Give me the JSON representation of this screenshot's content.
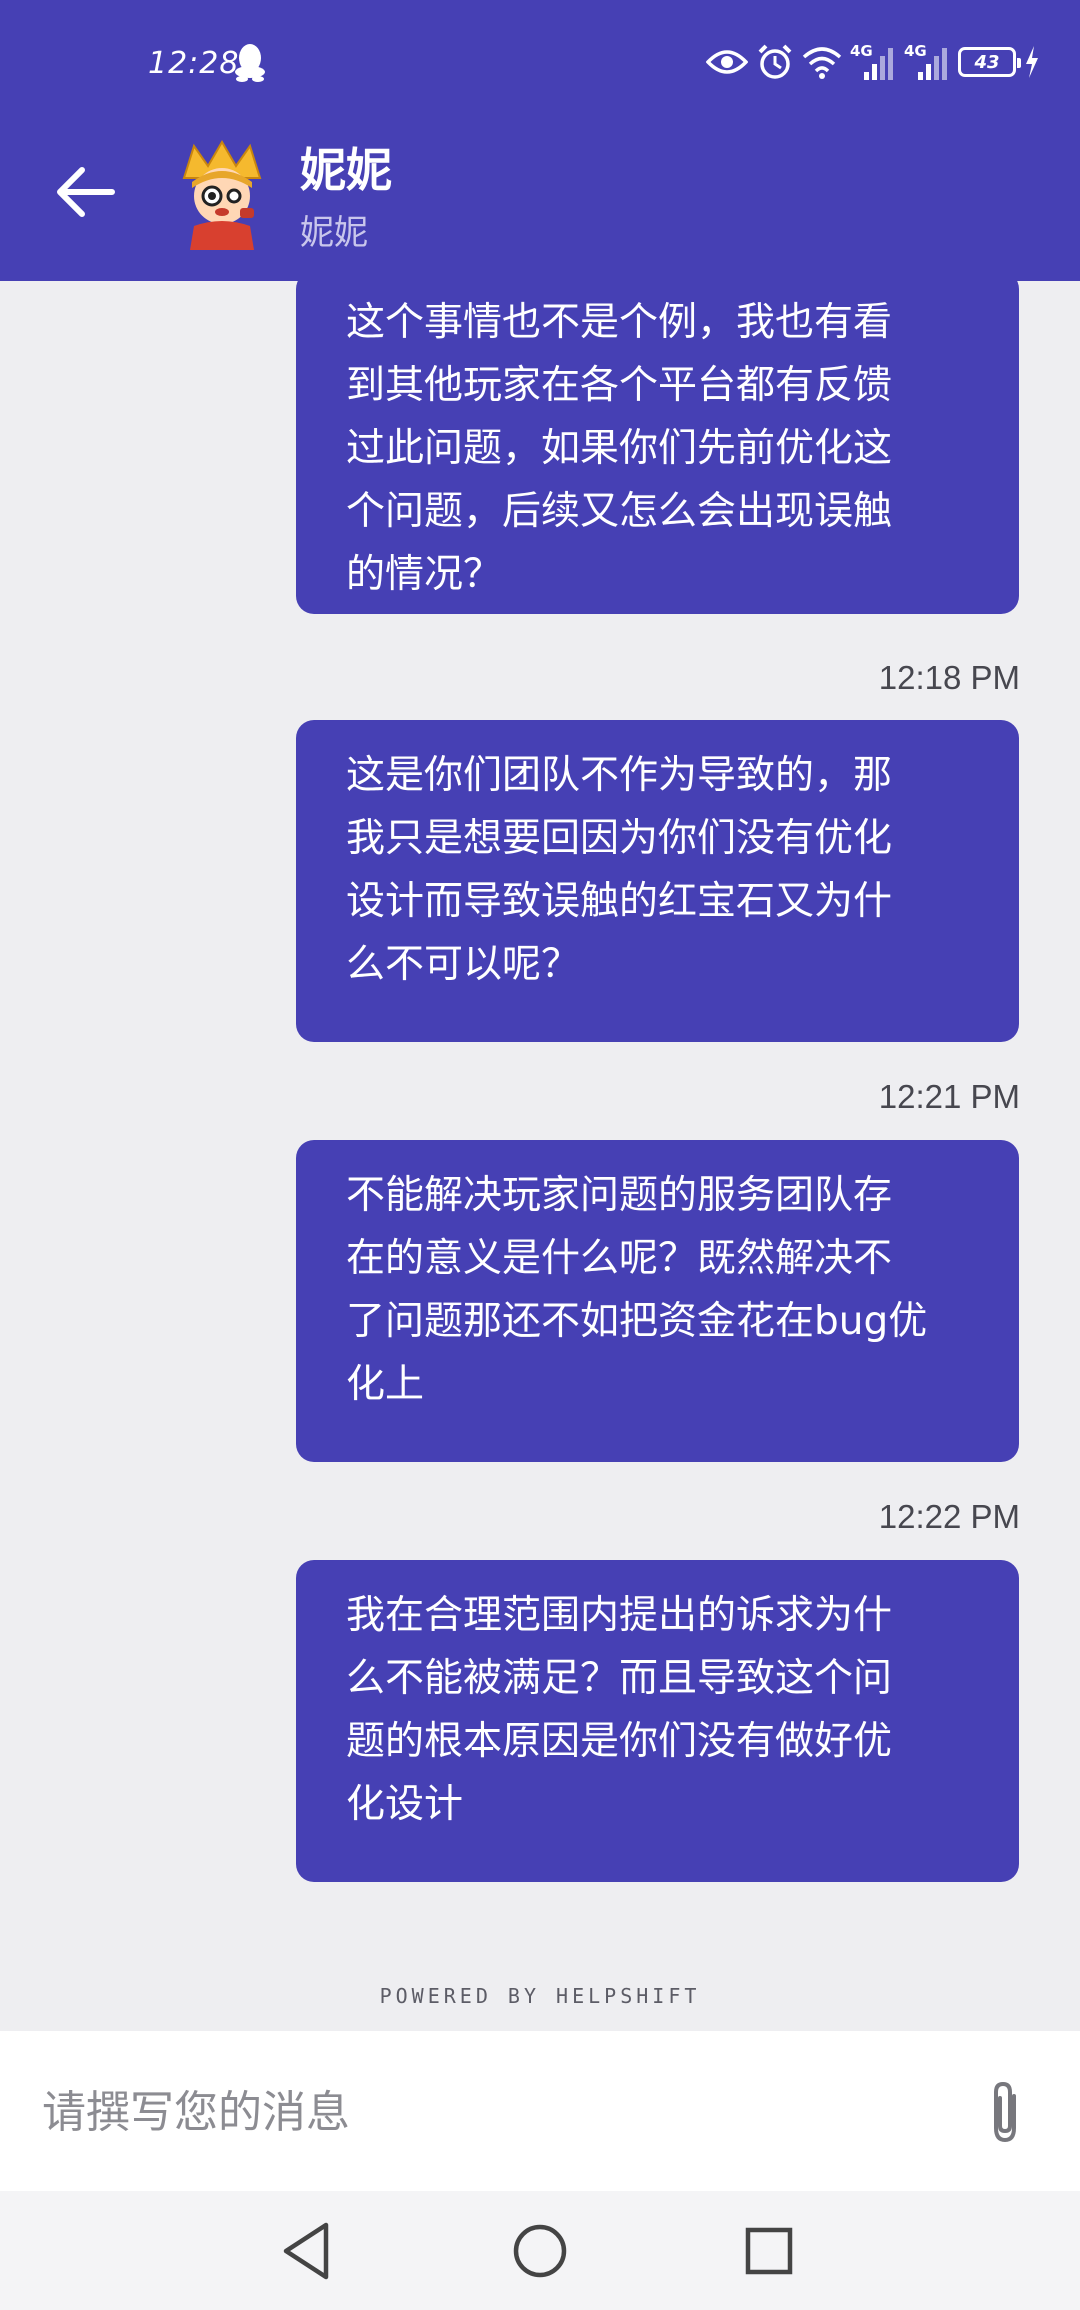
{
  "status_bar": {
    "time": "12:28",
    "network_1": "4G",
    "network_2": "4G",
    "battery": "43"
  },
  "header": {
    "contact_name": "妮妮",
    "contact_subtitle": "妮妮"
  },
  "messages": [
    {
      "lines": [
        "这个事情也不是个例，我也有看",
        "到其他玩家在各个平台都有反馈",
        "过此问题，如果你们先前优化这",
        "个问题，后续又怎么会出现误触",
        "的情况？"
      ],
      "time": "12:18 PM"
    },
    {
      "lines": [
        "这是你们团队不作为导致的，那",
        "我只是想要回因为你们没有优化",
        "设计而导致误触的红宝石又为什",
        "么不可以呢？"
      ],
      "time": "12:21 PM"
    },
    {
      "lines": [
        "不能解决玩家问题的服务团队存",
        "在的意义是什么呢？既然解决不",
        "了问题那还不如把资金花在bug优",
        "化上"
      ],
      "time": "12:22 PM"
    },
    {
      "lines": [
        "我在合理范围内提出的诉求为什",
        "么不能被满足？而且导致这个问",
        "题的根本原因是你们没有做好优",
        "化设计"
      ],
      "time": ""
    }
  ],
  "footer": {
    "powered_by": "POWERED BY HELPSHIFT"
  },
  "composer": {
    "placeholder": "请撰写您的消息",
    "value": ""
  },
  "colors": {
    "brand": "#4640b4",
    "background": "#eeeef1"
  },
  "icons": [
    "back-arrow-icon",
    "paperclip-icon",
    "nav-back-icon",
    "nav-home-icon",
    "nav-recents-icon"
  ]
}
